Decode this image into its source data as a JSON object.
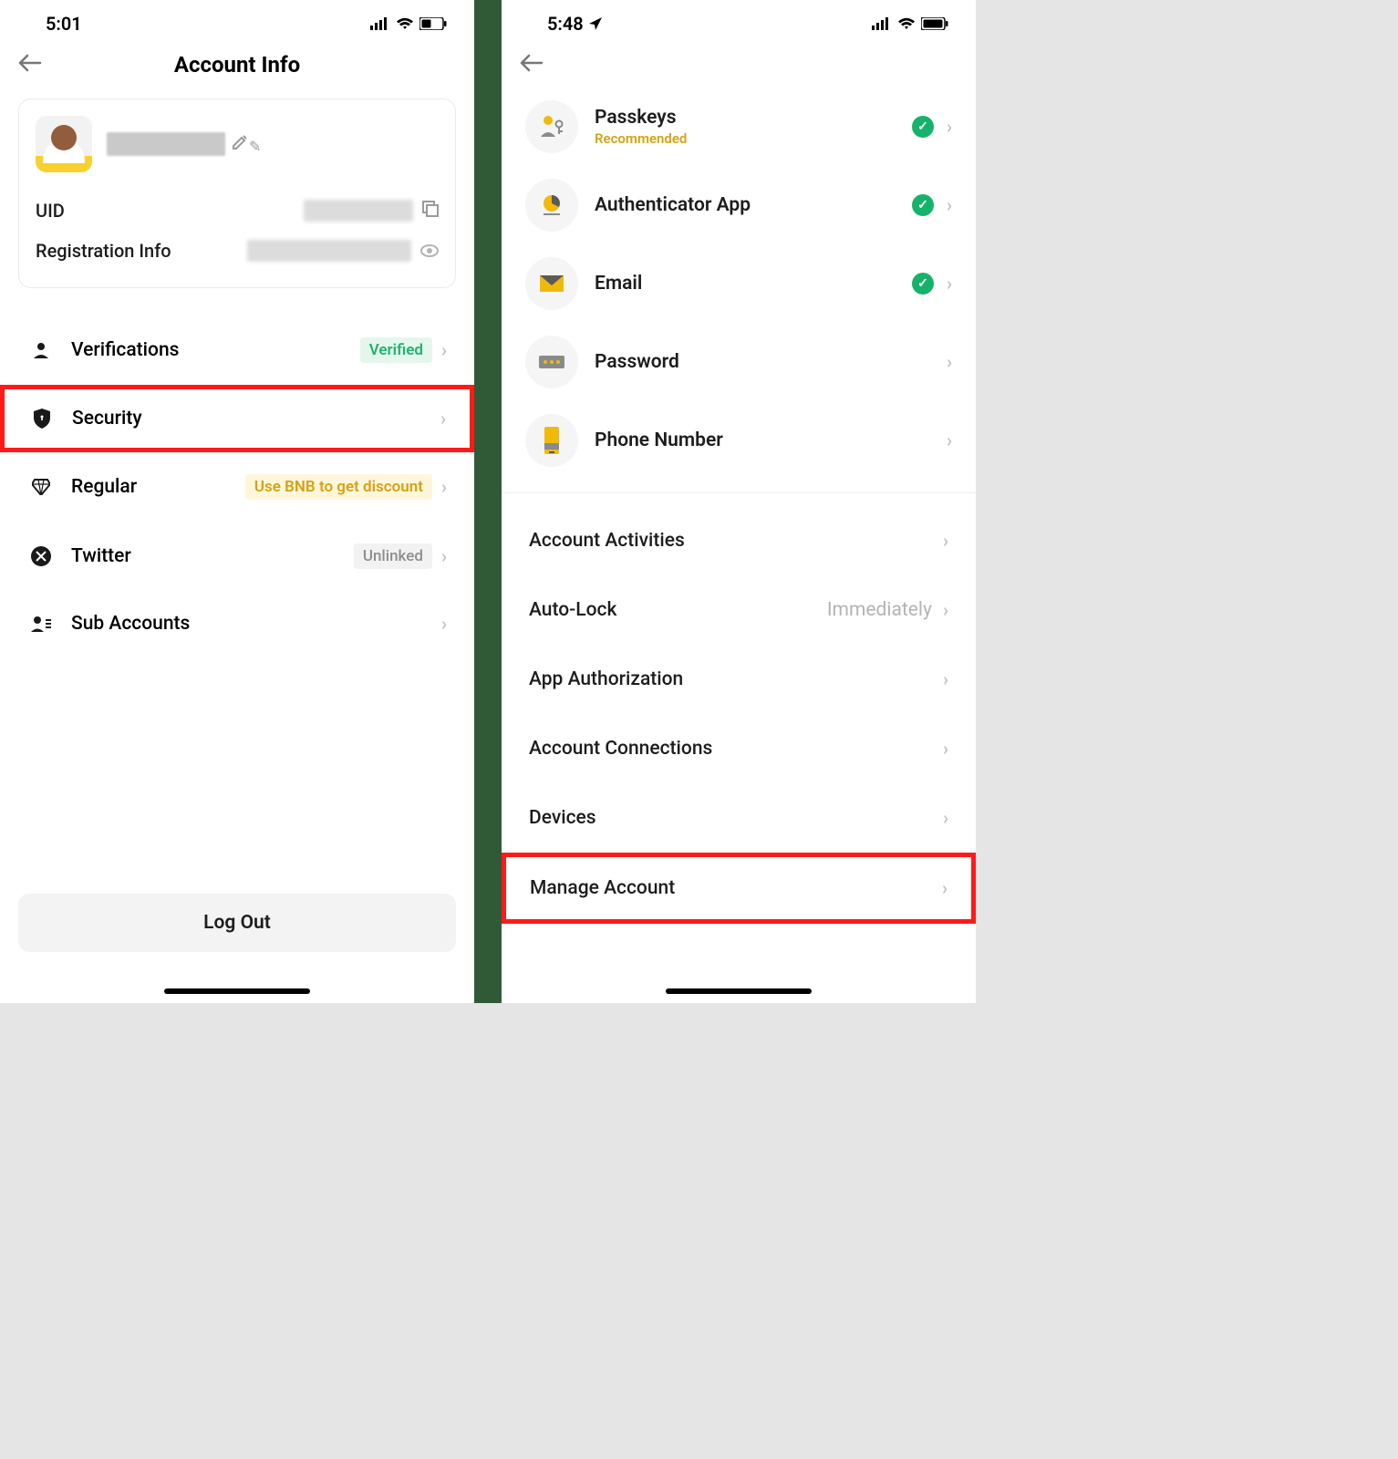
{
  "left": {
    "status_time": "5:01",
    "title": "Account Info",
    "card": {
      "uid_label": "UID",
      "reg_label": "Registration Info"
    },
    "rows": {
      "verifications": "Verifications",
      "verifications_badge": "Verified",
      "security": "Security",
      "regular": "Regular",
      "regular_badge": "Use BNB to get discount",
      "twitter": "Twitter",
      "twitter_badge": "Unlinked",
      "sub": "Sub Accounts"
    },
    "logout": "Log Out"
  },
  "right": {
    "status_time": "5:48",
    "items": {
      "passkeys": "Passkeys",
      "passkeys_sub": "Recommended",
      "auth": "Authenticator App",
      "email": "Email",
      "password": "Password",
      "phone": "Phone Number",
      "activities": "Account Activities",
      "autolock": "Auto-Lock",
      "autolock_val": "Immediately",
      "appauth": "App Authorization",
      "conns": "Account Connections",
      "devices": "Devices",
      "manage": "Manage Account"
    }
  }
}
